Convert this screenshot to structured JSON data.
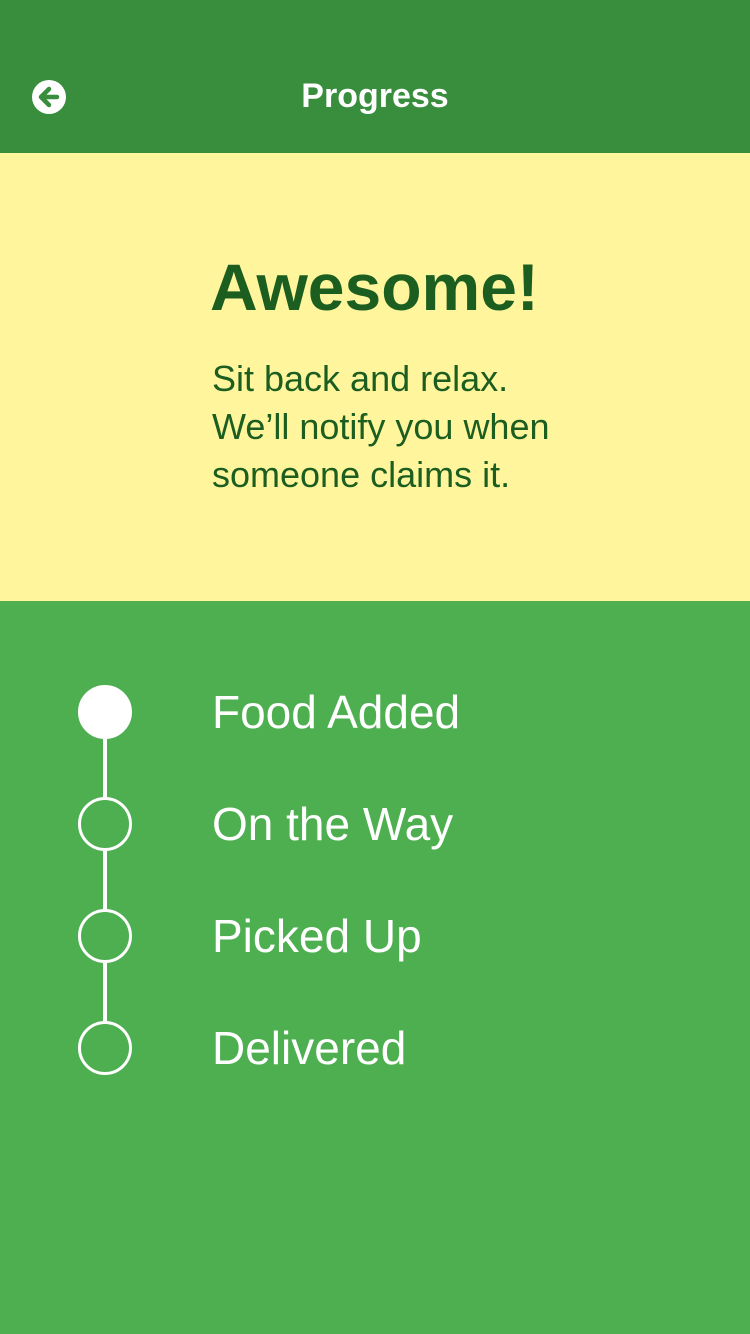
{
  "header": {
    "title": "Progress",
    "back_icon": "arrow-left-circle-icon"
  },
  "banner": {
    "heading": "Awesome!",
    "lines": [
      "Sit back and relax.",
      "We’ll notify you when",
      "someone claims it."
    ]
  },
  "progress": {
    "steps": [
      {
        "label": "Food Added",
        "completed": true
      },
      {
        "label": "On the Way",
        "completed": false
      },
      {
        "label": "Picked Up",
        "completed": false
      },
      {
        "label": "Delivered",
        "completed": false
      }
    ]
  },
  "colors": {
    "header": "#388e3c",
    "banner": "#fff59d",
    "banner_text": "#1b5e20",
    "body": "#4eaf50",
    "step": "#ffffff"
  }
}
